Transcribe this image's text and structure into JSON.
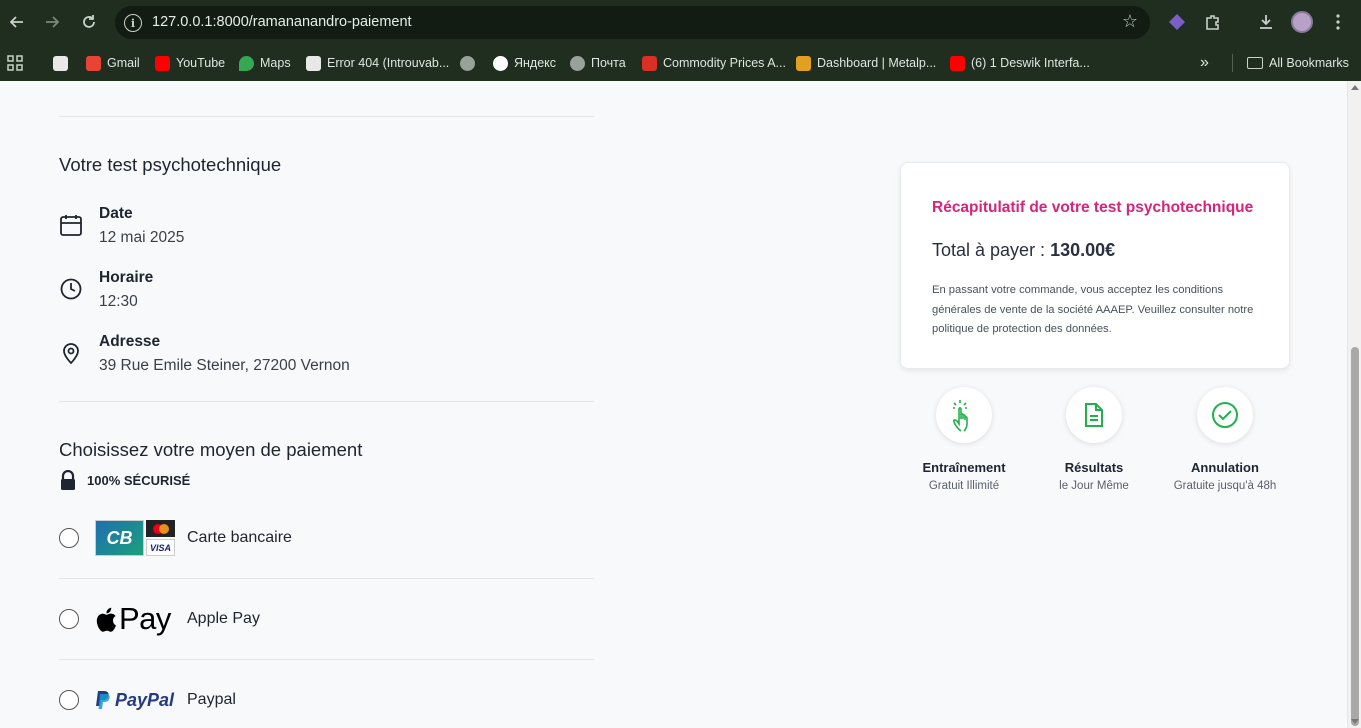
{
  "browser": {
    "url": "127.0.0.1:8000/ramananandro-paiement",
    "bookmarks": [
      {
        "label": "Gmail",
        "color": "#ea4335"
      },
      {
        "label": "YouTube",
        "color": "#ff0000"
      },
      {
        "label": "Maps",
        "color": "#34a853"
      },
      {
        "label": "Error 404 (Introuvab...",
        "color": "#e8e8e8"
      },
      {
        "label": "",
        "color": "#9aa09a"
      },
      {
        "label": "Яндекс",
        "color": "#ffffff"
      },
      {
        "label": "Почта",
        "color": "#9aa09a"
      },
      {
        "label": "Commodity Prices A...",
        "color": "#d93025"
      },
      {
        "label": "Dashboard | Metalp...",
        "color": "#e0a020"
      },
      {
        "label": "(6) 1 Deswik Interfa...",
        "color": "#ff0000"
      }
    ],
    "more_label": "»",
    "all_bookmarks": "All Bookmarks"
  },
  "test": {
    "heading": "Votre test psychotechnique",
    "date_label": "Date",
    "date_value": "12 mai 2025",
    "time_label": "Horaire",
    "time_value": "12:30",
    "address_label": "Adresse",
    "address_value": "39 Rue Emile Steiner, 27200 Vernon"
  },
  "payment": {
    "heading": "Choisissez votre moyen de paiement",
    "secure_label": "100% SÉCURISÉ",
    "methods": [
      {
        "label": "Carte bancaire",
        "logo": "cb-visa-mastercard"
      },
      {
        "label": "Apple Pay",
        "logo": "apple-pay",
        "logo_text": "Pay"
      },
      {
        "label": "Paypal",
        "logo": "paypal",
        "logo_text": "PayPal"
      }
    ]
  },
  "summary": {
    "title": "Récapitulatif de votre test psychotechnique",
    "total_prefix": "Total à payer : ",
    "total_value": "130.00€",
    "terms": "En passant votre commande, vous acceptez les conditions générales de vente de la société AAAEP. Veuillez consulter notre politique de protection des données."
  },
  "features": [
    {
      "title": "Entraînement",
      "subtitle": "Gratuit Illimité",
      "icon": "hand-pointer-icon"
    },
    {
      "title": "Résultats",
      "subtitle": "le Jour Même",
      "icon": "document-icon"
    },
    {
      "title": "Annulation",
      "subtitle": "Gratuite jusqu'à 48h",
      "icon": "check-circle-icon"
    }
  ],
  "colors": {
    "accent": "#d6247a",
    "green": "#22b04b",
    "chrome": "#1f2e1f"
  }
}
